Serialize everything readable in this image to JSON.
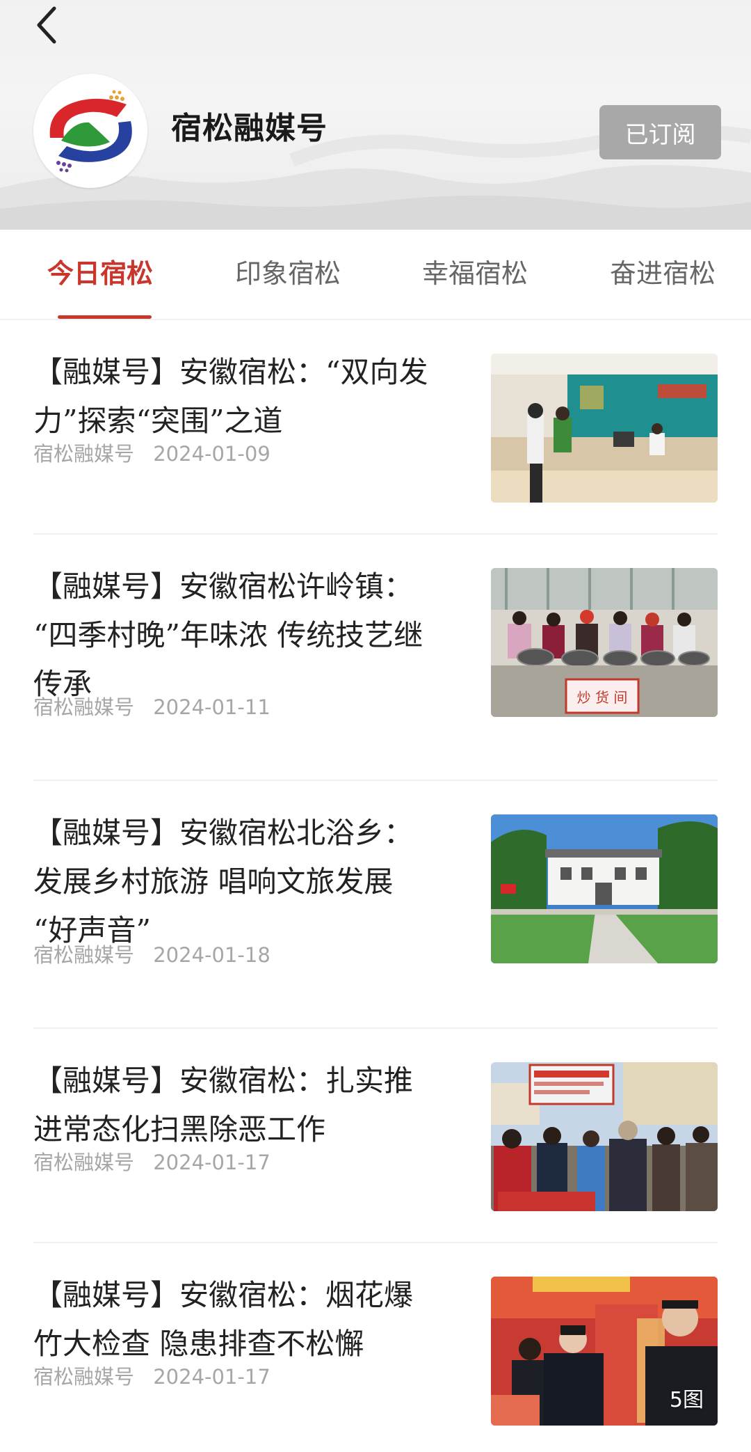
{
  "header": {
    "channel_name": "宿松融媒号",
    "subscribe_label": "已订阅",
    "back_icon": "chevron-left-icon"
  },
  "tabs": [
    {
      "label": "今日宿松",
      "active": true
    },
    {
      "label": "印象宿松",
      "active": false
    },
    {
      "label": "幸福宿松",
      "active": false
    },
    {
      "label": "奋进宿松",
      "active": false
    }
  ],
  "articles": [
    {
      "title_lines": [
        "【融媒号】安徽宿松：“双向发",
        "力”探索“突围”之道"
      ],
      "source": "宿松融媒号",
      "date": "2024-01-09",
      "badge": ""
    },
    {
      "title_lines": [
        "【融媒号】安徽宿松许岭镇：",
        "“四季村晚”年味浓 传统技艺继",
        "传承"
      ],
      "source": "宿松融媒号",
      "date": "2024-01-11",
      "badge": "",
      "image_text": "炒 货 间"
    },
    {
      "title_lines": [
        "【融媒号】安徽宿松北浴乡：",
        "发展乡村旅游 唱响文旅发展",
        "“好声音”"
      ],
      "source": "宿松融媒号",
      "date": "2024-01-18",
      "badge": ""
    },
    {
      "title_lines": [
        "【融媒号】安徽宿松：扎实推",
        "进常态化扫黑除恶工作"
      ],
      "source": "宿松融媒号",
      "date": "2024-01-17",
      "badge": ""
    },
    {
      "title_lines": [
        "【融媒号】安徽宿松：烟花爆",
        "竹大检查 隐患排查不松懈"
      ],
      "source": "宿松融媒号",
      "date": "2024-01-17",
      "badge": "5图"
    }
  ],
  "colors": {
    "accent": "#c9372c",
    "subscribe_bg": "#a8a8a8",
    "meta_text": "#a6a6a6"
  }
}
